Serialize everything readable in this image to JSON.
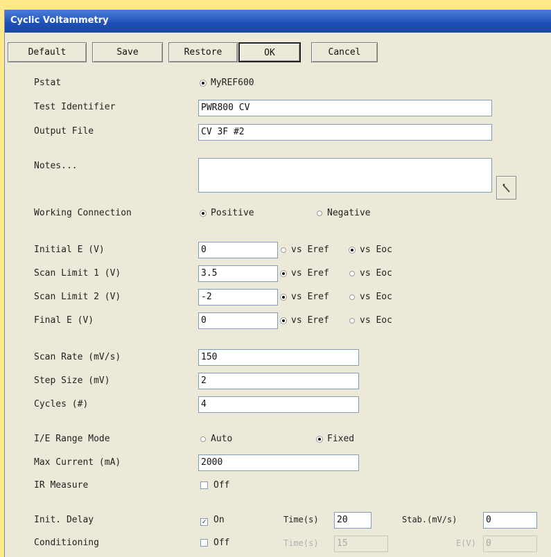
{
  "window": {
    "title": "Cyclic Voltammetry"
  },
  "toolbar": {
    "default_label": "Default",
    "save_label": "Save",
    "restore_label": "Restore",
    "ok_label": "OK",
    "cancel_label": "Cancel"
  },
  "pstat": {
    "label": "Pstat",
    "value": "MyREF600"
  },
  "test_identifier": {
    "label": "Test Identifier",
    "value": "PWR800 CV"
  },
  "output_file": {
    "label": "Output File",
    "value": "CV 3F #2"
  },
  "notes": {
    "label": "Notes...",
    "value": "",
    "icon": "pencil-icon"
  },
  "working_connection": {
    "label": "Working Connection",
    "options": [
      "Positive",
      "Negative"
    ],
    "selected": "Positive"
  },
  "potentials": [
    {
      "label": "Initial E (V)",
      "value": "0",
      "vs_eref": "vs Eref",
      "vs_eoc": "vs Eoc",
      "selected": "vs Eoc"
    },
    {
      "label": "Scan Limit 1 (V)",
      "value": "3.5",
      "vs_eref": "vs Eref",
      "vs_eoc": "vs Eoc",
      "selected": "vs Eref"
    },
    {
      "label": "Scan Limit 2 (V)",
      "value": "-2",
      "vs_eref": "vs Eref",
      "vs_eoc": "vs Eoc",
      "selected": "vs Eref"
    },
    {
      "label": "Final E (V)",
      "value": "0",
      "vs_eref": "vs Eref",
      "vs_eoc": "vs Eoc",
      "selected": "vs Eref"
    }
  ],
  "scan_rate": {
    "label": "Scan Rate (mV/s)",
    "value": "150"
  },
  "step_size": {
    "label": "Step Size (mV)",
    "value": "2"
  },
  "cycles": {
    "label": "Cycles (#)",
    "value": "4"
  },
  "ie_range_mode": {
    "label": "I/E Range Mode",
    "options": [
      "Auto",
      "Fixed"
    ],
    "selected": "Fixed"
  },
  "max_current": {
    "label": "Max Current (mA)",
    "value": "2000"
  },
  "ir_measure": {
    "label": "IR Measure",
    "checkbox_label": "Off",
    "checked": false
  },
  "init_delay": {
    "label": "Init. Delay",
    "checkbox_label": "On",
    "checked": true,
    "time_label": "Time(s)",
    "time_value": "20",
    "stab_label": "Stab.(mV/s)",
    "stab_value": "0"
  },
  "conditioning": {
    "label": "Conditioning",
    "checkbox_label": "Off",
    "checked": false,
    "time_label": "Time(s)",
    "time_value": "15",
    "e_label": "E(V)",
    "e_value": "0"
  }
}
